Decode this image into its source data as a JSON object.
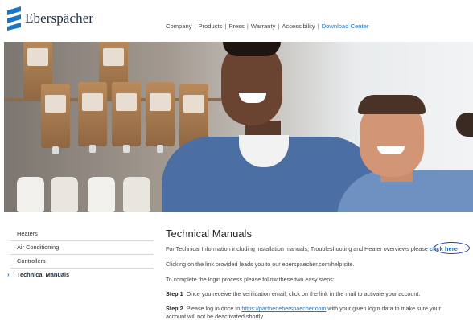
{
  "brand": {
    "name": "Eberspächer",
    "logo_color": "#1a75c4"
  },
  "nav": {
    "items": [
      "Company",
      "Products",
      "Press",
      "Warranty",
      "Accessibility",
      "Download Center"
    ],
    "separator": "|"
  },
  "sidebar": {
    "items": [
      "Heaters",
      "Air Conditioning",
      "Controllers",
      "Technical Manuals"
    ],
    "active_item": "Technical Manuals",
    "active_marker": "›"
  },
  "content": {
    "title": "Technical Manuals",
    "intro": "For Technical Information including installation manuals, Troubleshooting and Heater overviews please",
    "click_here": "click here",
    "line2": "Clicking on the link provided leads you to our eberspaecher.com/help site.",
    "line3": "To complete the login process please follow these two easy steps:",
    "step1_label": "Step 1",
    "step1_text": "Once you receive the verification email, click on the link in the mail to activate your account.",
    "step2_label": "Step 2",
    "step2_pre": "Please log in once to",
    "step2_link": "https://partner.eberspaecher.com",
    "step2_post": "with your given login data to make sure your",
    "step2_line2": "account will not be deactivated shortly."
  },
  "colors": {
    "link": "#1a75c4",
    "annotation": "#2b3aa7"
  }
}
